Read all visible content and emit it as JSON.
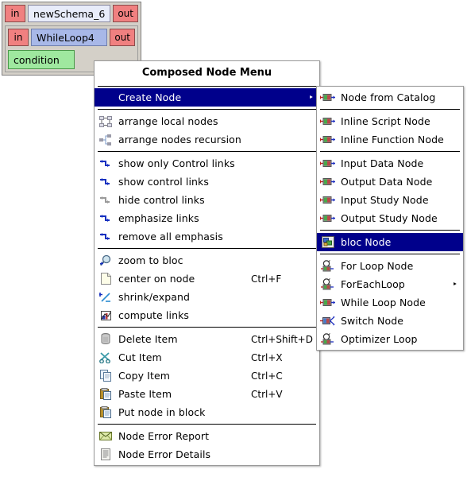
{
  "canvas": {
    "outer_node": {
      "in_port": "in",
      "title": "newSchema_6",
      "out_port": "out"
    },
    "inner_node": {
      "in_port": "in",
      "title": "WhileLoop4",
      "out_port": "out",
      "condition_label": "condition"
    }
  },
  "main_menu": {
    "title": "Composed Node Menu",
    "groups": [
      {
        "items": [
          {
            "label": "Create Node",
            "icon": "submenu-arrow-icon",
            "shortcut": "",
            "selected": true,
            "has_submenu": true
          }
        ]
      },
      {
        "items": [
          {
            "label": "arrange local nodes",
            "icon": "arrange-grid-icon",
            "shortcut": "",
            "selected": false,
            "has_submenu": false
          },
          {
            "label": "arrange nodes recursion",
            "icon": "arrange-tree-icon",
            "shortcut": "",
            "selected": false,
            "has_submenu": false
          }
        ]
      },
      {
        "items": [
          {
            "label": "show only Control links",
            "icon": "control-link-icon",
            "shortcut": "",
            "selected": false,
            "has_submenu": false
          },
          {
            "label": "show control links",
            "icon": "control-link-icon",
            "shortcut": "",
            "selected": false,
            "has_submenu": false
          },
          {
            "label": "hide control links",
            "icon": "control-link-gray-icon",
            "shortcut": "",
            "selected": false,
            "has_submenu": false
          },
          {
            "label": "emphasize links",
            "icon": "control-link-icon",
            "shortcut": "",
            "selected": false,
            "has_submenu": false
          },
          {
            "label": "remove all emphasis",
            "icon": "control-link-icon",
            "shortcut": "",
            "selected": false,
            "has_submenu": false
          }
        ]
      },
      {
        "items": [
          {
            "label": "zoom to bloc",
            "icon": "magnifier-plus-icon",
            "shortcut": "",
            "selected": false,
            "has_submenu": false
          },
          {
            "label": "center on node",
            "icon": "document-icon",
            "shortcut": "Ctrl+F",
            "selected": false,
            "has_submenu": false
          },
          {
            "label": "shrink/expand",
            "icon": "shrink-expand-icon",
            "shortcut": "",
            "selected": false,
            "has_submenu": false
          },
          {
            "label": "compute links",
            "icon": "compute-links-icon",
            "shortcut": "",
            "selected": false,
            "has_submenu": false
          }
        ]
      },
      {
        "items": [
          {
            "label": "Delete Item",
            "icon": "trash-icon",
            "shortcut": "Ctrl+Shift+D",
            "selected": false,
            "has_submenu": false
          },
          {
            "label": "Cut Item",
            "icon": "scissors-icon",
            "shortcut": "Ctrl+X",
            "selected": false,
            "has_submenu": false
          },
          {
            "label": "Copy Item",
            "icon": "copy-icon",
            "shortcut": "Ctrl+C",
            "selected": false,
            "has_submenu": false
          },
          {
            "label": "Paste Item",
            "icon": "paste-icon",
            "shortcut": "Ctrl+V",
            "selected": false,
            "has_submenu": false
          },
          {
            "label": "Put node in block",
            "icon": "paste-icon",
            "shortcut": "",
            "selected": false,
            "has_submenu": false
          }
        ]
      },
      {
        "items": [
          {
            "label": "Node Error Report",
            "icon": "envelope-icon",
            "shortcut": "",
            "selected": false,
            "has_submenu": false
          },
          {
            "label": "Node Error Details",
            "icon": "list-document-icon",
            "shortcut": "",
            "selected": false,
            "has_submenu": false
          }
        ]
      }
    ]
  },
  "sub_menu": {
    "groups": [
      {
        "items": [
          {
            "label": "Node from Catalog",
            "icon": "node-block-icon",
            "selected": false,
            "has_submenu": false
          }
        ]
      },
      {
        "items": [
          {
            "label": "Inline Script Node",
            "icon": "node-block-icon",
            "selected": false,
            "has_submenu": false
          },
          {
            "label": "Inline Function Node",
            "icon": "node-block-icon",
            "selected": false,
            "has_submenu": false
          }
        ]
      },
      {
        "items": [
          {
            "label": "Input Data Node",
            "icon": "node-block-icon",
            "selected": false,
            "has_submenu": false
          },
          {
            "label": "Output Data Node",
            "icon": "node-block-icon",
            "selected": false,
            "has_submenu": false
          },
          {
            "label": "Input Study Node",
            "icon": "node-block-icon",
            "selected": false,
            "has_submenu": false
          },
          {
            "label": "Output Study Node",
            "icon": "node-block-icon",
            "selected": false,
            "has_submenu": false
          }
        ]
      },
      {
        "items": [
          {
            "label": "bloc Node",
            "icon": "bloc-node-icon",
            "selected": true,
            "has_submenu": false
          }
        ]
      },
      {
        "items": [
          {
            "label": "For Loop Node",
            "icon": "loop-node-icon",
            "selected": false,
            "has_submenu": false
          },
          {
            "label": "ForEachLoop",
            "icon": "loop-node-icon",
            "selected": false,
            "has_submenu": true
          },
          {
            "label": "While Loop Node",
            "icon": "node-block-icon",
            "selected": false,
            "has_submenu": false
          },
          {
            "label": "Switch Node",
            "icon": "switch-node-icon",
            "selected": false,
            "has_submenu": false
          },
          {
            "label": "Optimizer Loop",
            "icon": "loop-node-icon",
            "selected": false,
            "has_submenu": false
          }
        ]
      }
    ]
  },
  "colors": {
    "highlight": "#00008b",
    "highlight_text": "#ffffff",
    "port": "#f08080",
    "outer_title": "#e8ecfa",
    "inner_title": "#a8b8e8",
    "condition": "#9fe89f",
    "node_frame": "#d4d0c8",
    "canvas_bg": "#ffffff"
  }
}
